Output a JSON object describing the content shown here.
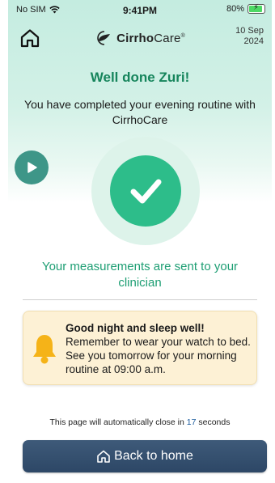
{
  "status_bar": {
    "carrier": "No SIM",
    "time": "9:41PM",
    "battery": "80%"
  },
  "header": {
    "logo_bold": "Cirrho",
    "logo_rest": "Care",
    "logo_mark": "®",
    "date_line1": "10 Sep",
    "date_line2": "2024"
  },
  "content": {
    "title": "Well done Zuri!",
    "subtitle": "You have completed your evening routine with CirrhoCare",
    "sent_message": "Your measurements are sent to your clinician"
  },
  "night_card": {
    "title": "Good night and sleep well!",
    "body": "Remember to wear your watch to bed. See you tomorrow for your morning routine at 09:00 a.m."
  },
  "footer": {
    "close_prefix": "This page will automatically close in",
    "close_seconds": "17",
    "close_suffix": "seconds",
    "back_label": "Back to home"
  },
  "colors": {
    "accent_green": "#16855c",
    "check_green": "#2dbd8a",
    "button_navy": "#2d4766",
    "card_bg": "#fdf1d5"
  },
  "icons": {
    "home": "home-icon",
    "play": "play-icon",
    "check": "checkmark-icon",
    "bell": "bell-icon",
    "wifi": "wifi-icon",
    "battery": "battery-icon"
  }
}
